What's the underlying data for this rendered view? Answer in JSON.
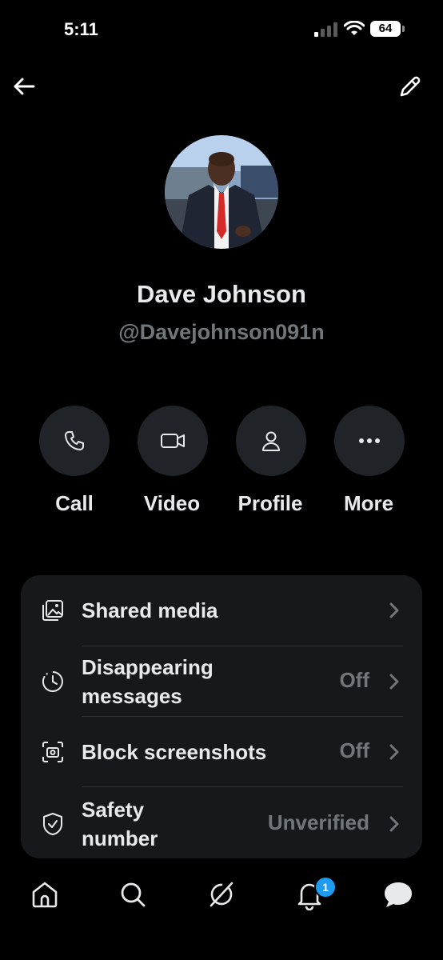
{
  "status_bar": {
    "time": "5:11",
    "battery": "64"
  },
  "profile": {
    "name": "Dave Johnson",
    "handle": "@Davejohnson091n"
  },
  "actions": [
    {
      "label": "Call",
      "icon": "phone-icon"
    },
    {
      "label": "Video",
      "icon": "video-camera-icon"
    },
    {
      "label": "Profile",
      "icon": "person-icon"
    },
    {
      "label": "More",
      "icon": "more-dots-icon"
    }
  ],
  "settings": [
    {
      "label": "Shared media",
      "value": "",
      "icon": "shared-media-icon"
    },
    {
      "label": "Disappearing messages",
      "value": "Off",
      "icon": "timer-icon"
    },
    {
      "label": "Block screenshots",
      "value": "Off",
      "icon": "screenshot-icon"
    },
    {
      "label": "Safety number",
      "value": "Unverified",
      "icon": "shield-check-icon"
    }
  ],
  "tab_bar": {
    "items": [
      "home-icon",
      "search-icon",
      "grok-icon",
      "notifications-icon",
      "messages-icon"
    ],
    "notification_count": "1"
  },
  "colors": {
    "background": "#000000",
    "card": "#16181c",
    "button": "#202327",
    "muted": "#71767b",
    "accent": "#1d9bf0"
  }
}
